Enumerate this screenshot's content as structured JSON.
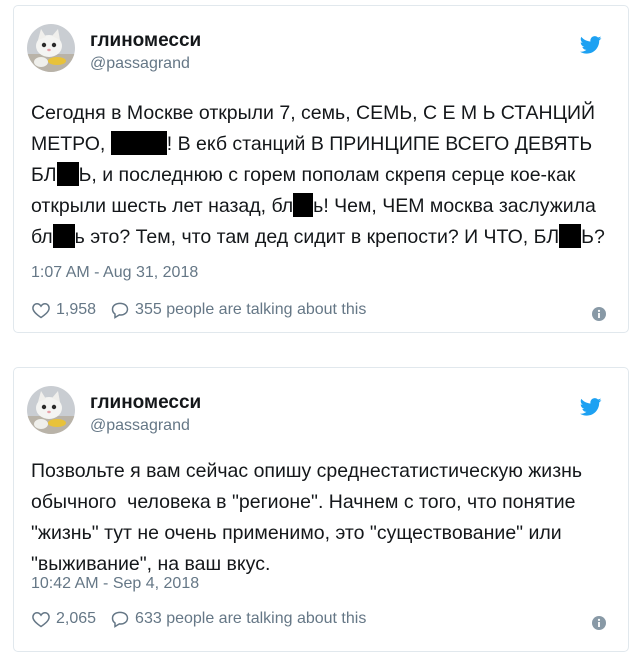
{
  "colors": {
    "brand_blue": "#1da1f2",
    "name": "#14171a",
    "secondary": "#657786",
    "border": "#e1e8ed",
    "redaction": "#000000"
  },
  "tweets": [
    {
      "author": {
        "name": "глиномесси",
        "handle": "@passagrand",
        "avatar_icon": "cat-avatar"
      },
      "brand_icon": "twitter-bird-icon",
      "text_segments": [
        "Сегодня в Москве открыли 7, семь, СЕМЬ, С Е М Ь СТАНЦИЙ МЕТРО, ",
        "! В екб станций В ПРИНЦИПЕ ВСЕГО ДЕВЯТЬ БЛ",
        "Ь, и последнюю с горем пополам скрепя серце кое-как открыли шесть лет назад, бл",
        "ь! Чем, ЧЕМ москва заслужила бл",
        "ь это? Тем, что там дед сидит в крепости? И ЧТО, БЛ",
        "Ь?"
      ],
      "timestamp": "1:07 AM - Aug 31, 2018",
      "likes": "1,958",
      "talking": "355 people are talking about this",
      "like_icon": "heart-icon",
      "reply_icon": "speech-bubble-icon",
      "info_icon": "info-icon"
    },
    {
      "author": {
        "name": "глиномесси",
        "handle": "@passagrand",
        "avatar_icon": "cat-avatar"
      },
      "brand_icon": "twitter-bird-icon",
      "text": "Позвольте я вам сейчас опишу среднестатистическую жизнь обычного  человека в \"регионе\". Начнем с того, что понятие \"жизнь\" тут не очень применимо, это \"существование\" или \"выживание\", на ваш вкус.",
      "timestamp": "10:42 AM - Sep 4, 2018",
      "likes": "2,065",
      "talking": "633 people are talking about this",
      "like_icon": "heart-icon",
      "reply_icon": "speech-bubble-icon",
      "info_icon": "info-icon"
    }
  ]
}
